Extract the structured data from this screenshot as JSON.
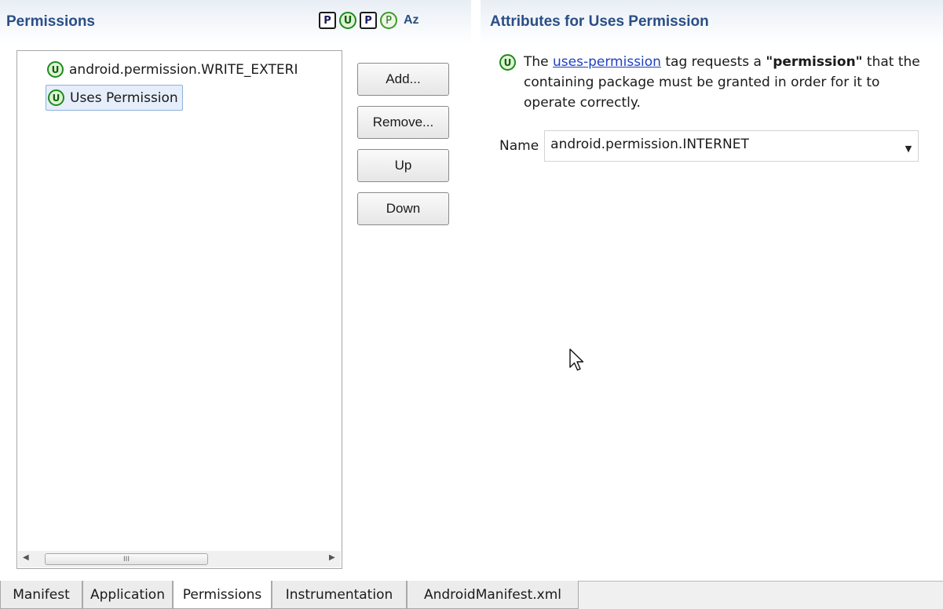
{
  "permissions_header": {
    "title": "Permissions",
    "icons": [
      "permission-square-icon",
      "uses-permission-icon",
      "permission-tree-square-icon",
      "permission-group-icon",
      "sort-alpha-icon"
    ],
    "icon_glyphs": [
      "P",
      "U",
      "P",
      "P",
      "Az"
    ]
  },
  "attributes_header": {
    "title": "Attributes for Uses Permission"
  },
  "tree": {
    "nodes": [
      {
        "icon": "U",
        "label": "android.permission.WRITE_EXTERI",
        "selected": false
      },
      {
        "icon": "U",
        "label": "Uses Permission",
        "selected": true
      }
    ],
    "scroll_grip": "III"
  },
  "buttons": {
    "add": "Add...",
    "remove": "Remove...",
    "up": "Up",
    "down": "Down"
  },
  "description": {
    "icon": "U",
    "prefix": "The ",
    "link": "uses-permission",
    "middle": " tag requests a ",
    "bold": "\"permission\"",
    "suffix": " that the containing package must be granted in order for it to operate correctly."
  },
  "name_field": {
    "label": "Name",
    "value": "android.permission.INTERNET"
  },
  "tabs": [
    {
      "label": "Manifest",
      "active": false
    },
    {
      "label": "Application",
      "active": false
    },
    {
      "label": "Permissions",
      "active": true
    },
    {
      "label": "Instrumentation",
      "active": false
    },
    {
      "label": "AndroidManifest.xml",
      "active": false
    }
  ],
  "colors": {
    "header_text": "#2a4e86",
    "icon_green": "#1e8a1e",
    "link": "#1f3fbf",
    "selection_bg": "#e5eefa"
  }
}
